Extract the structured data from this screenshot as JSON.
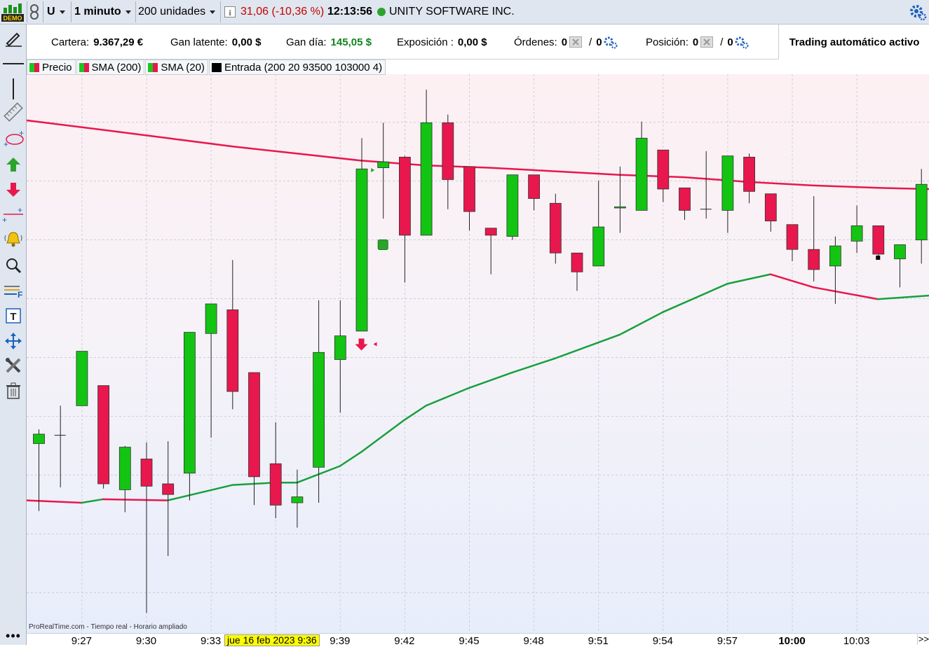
{
  "toolbar": {
    "demo_label": "DEMO",
    "ticker": "U",
    "timeframe": "1 minuto",
    "units": "200 unidades",
    "price_change": "31,06 (-10,36 %)",
    "time": "12:13:56",
    "instrument": "UNITY SOFTWARE INC.",
    "colors": {
      "price_change": "#c40000",
      "status_dot": "#2ca42c"
    }
  },
  "info": {
    "cartera_label": "Cartera:",
    "cartera_value": "9.367,29 €",
    "gan_latente_label": "Gan latente:",
    "gan_latente_value": "0,00 $",
    "gan_dia_label": "Gan día:",
    "gan_dia_value": "145,05 $",
    "exposicion_label": "Exposición :",
    "exposicion_value": "0,00 $",
    "ordenes_label": "Órdenes:",
    "ordenes_a": "0",
    "ordenes_b": "0",
    "posicion_label": "Posición:",
    "posicion_a": "0",
    "posicion_b": "0",
    "auto_trading": "Trading automático activo",
    "colors": {
      "gan_dia": "#12851d"
    }
  },
  "legend": [
    {
      "label": "Precio",
      "swatch": "red-green"
    },
    {
      "label": "SMA (200)",
      "swatch": "red-green"
    },
    {
      "label": "SMA (20)",
      "swatch": "red-green"
    },
    {
      "label": "Entrada (200 20 93500 103000 4)",
      "swatch": "black"
    }
  ],
  "left_tools": [
    "pencil-icon",
    "horizontal-line-icon",
    "vertical-line-icon",
    "ruler-icon",
    "ellipse-icon",
    "arrow-up-icon",
    "arrow-down-icon",
    "add-line-icon",
    "alarm-bell-icon",
    "magnifier-icon",
    "fibonacci-icon",
    "text-icon",
    "move-icon",
    "settings-tools-icon",
    "trash-icon"
  ],
  "footer_note": "ProRealTime.com - Tiempo real - Horario ampliado",
  "date_box": "jue 16 feb 2023 9:36",
  "chart_data": {
    "type": "candlestick",
    "x_labels": [
      "9:27",
      "9:30",
      "9:33",
      "9:36",
      "9:39",
      "9:42",
      "9:45",
      "9:48",
      "9:51",
      "9:54",
      "9:57",
      "10:00",
      "10:03"
    ],
    "x_label_bold": "10:00",
    "colors": {
      "up": "#13c413",
      "down": "#e8174d",
      "sma200": "#e8174d",
      "sma20_up": "#17a03c",
      "sma20_down": "#e8174d"
    },
    "candles": [
      {
        "t": "9:25",
        "o": 29.6,
        "h": 29.72,
        "l": 29.03,
        "c": 29.68
      },
      {
        "t": "9:26",
        "o": 29.67,
        "h": 29.92,
        "l": 29.23,
        "c": 29.67
      },
      {
        "t": "9:27",
        "o": 29.92,
        "h": 30.38,
        "l": 29.92,
        "c": 30.38
      },
      {
        "t": "9:28",
        "o": 30.09,
        "h": 30.09,
        "l": 29.22,
        "c": 29.26
      },
      {
        "t": "9:29",
        "o": 29.21,
        "h": 29.58,
        "l": 29.02,
        "c": 29.57
      },
      {
        "t": "9:30",
        "o": 29.47,
        "h": 29.61,
        "l": 28.17,
        "c": 29.24
      },
      {
        "t": "9:31",
        "o": 29.26,
        "h": 29.62,
        "l": 28.65,
        "c": 29.17
      },
      {
        "t": "9:32",
        "o": 29.35,
        "h": 30.54,
        "l": 29.12,
        "c": 30.54
      },
      {
        "t": "9:33",
        "o": 30.53,
        "h": 30.7,
        "l": 29.65,
        "c": 30.78
      },
      {
        "t": "9:34",
        "o": 30.73,
        "h": 31.15,
        "l": 29.89,
        "c": 30.04
      },
      {
        "t": "9:35",
        "o": 30.2,
        "h": 30.2,
        "l": 29.08,
        "c": 29.32
      },
      {
        "t": "9:36",
        "o": 29.43,
        "h": 29.78,
        "l": 28.97,
        "c": 29.08
      },
      {
        "t": "9:37",
        "o": 29.1,
        "h": 29.38,
        "l": 28.89,
        "c": 29.15
      },
      {
        "t": "9:38",
        "o": 29.4,
        "h": 30.81,
        "l": 29.1,
        "c": 30.37
      },
      {
        "t": "9:39",
        "o": 30.31,
        "h": 30.81,
        "l": 29.86,
        "c": 30.51
      },
      {
        "t": "9:40",
        "o": 30.55,
        "h": 32.18,
        "l": 30.55,
        "c": 31.92
      },
      {
        "t": "9:41",
        "o": 31.93,
        "h": 32.31,
        "l": 31.5,
        "c": 31.98
      },
      {
        "t": "9:42",
        "o": 32.02,
        "h": 32.03,
        "l": 30.96,
        "c": 31.36
      },
      {
        "t": "9:43",
        "o": 31.36,
        "h": 32.59,
        "l": 31.36,
        "c": 32.31
      },
      {
        "t": "9:44",
        "o": 32.31,
        "h": 32.38,
        "l": 31.58,
        "c": 31.83
      },
      {
        "t": "9:45",
        "o": 31.94,
        "h": 31.94,
        "l": 31.4,
        "c": 31.56
      },
      {
        "t": "9:46",
        "o": 31.42,
        "h": 31.42,
        "l": 31.03,
        "c": 31.36
      },
      {
        "t": "9:47",
        "o": 31.35,
        "h": 31.87,
        "l": 31.32,
        "c": 31.87
      },
      {
        "t": "9:48",
        "o": 31.87,
        "h": 31.87,
        "l": 31.57,
        "c": 31.67
      },
      {
        "t": "9:49",
        "o": 31.63,
        "h": 31.71,
        "l": 31.12,
        "c": 31.21
      },
      {
        "t": "9:50",
        "o": 31.21,
        "h": 31.21,
        "l": 30.89,
        "c": 31.05
      },
      {
        "t": "9:51",
        "o": 31.1,
        "h": 31.82,
        "l": 31.1,
        "c": 31.43
      },
      {
        "t": "9:52",
        "o": 31.59,
        "h": 31.94,
        "l": 31.38,
        "c": 31.6
      },
      {
        "t": "9:53",
        "o": 31.57,
        "h": 32.32,
        "l": 31.57,
        "c": 32.18
      },
      {
        "t": "9:54",
        "o": 32.08,
        "h": 32.08,
        "l": 31.64,
        "c": 31.75
      },
      {
        "t": "9:55",
        "o": 31.76,
        "h": 31.76,
        "l": 31.49,
        "c": 31.57
      },
      {
        "t": "9:56",
        "o": 31.58,
        "h": 32.07,
        "l": 31.5,
        "c": 31.58
      },
      {
        "t": "9:57",
        "o": 31.57,
        "h": 32.02,
        "l": 31.38,
        "c": 32.03
      },
      {
        "t": "9:58",
        "o": 32.02,
        "h": 32.05,
        "l": 31.63,
        "c": 31.73
      },
      {
        "t": "9:59",
        "o": 31.71,
        "h": 31.71,
        "l": 31.39,
        "c": 31.48
      },
      {
        "t": "10:00",
        "o": 31.45,
        "h": 31.45,
        "l": 31.14,
        "c": 31.24
      },
      {
        "t": "10:01",
        "o": 31.24,
        "h": 31.69,
        "l": 30.97,
        "c": 31.07
      },
      {
        "t": "10:02",
        "o": 31.1,
        "h": 31.35,
        "l": 30.78,
        "c": 31.27
      },
      {
        "t": "10:03",
        "o": 31.31,
        "h": 31.61,
        "l": 31.21,
        "c": 31.44
      },
      {
        "t": "10:04",
        "o": 31.44,
        "h": 31.44,
        "l": 31.17,
        "c": 31.2
      },
      {
        "t": "10:05",
        "o": 31.16,
        "h": 31.16,
        "l": 30.92,
        "c": 31.28
      },
      {
        "t": "10:06",
        "o": 31.32,
        "h": 31.92,
        "l": 31.12,
        "c": 31.79
      }
    ],
    "sma200": [
      {
        "t": "9:25",
        "v": 32.33
      },
      {
        "t": "9:28",
        "v": 32.25
      },
      {
        "t": "9:31",
        "v": 32.18
      },
      {
        "t": "9:34",
        "v": 32.11
      },
      {
        "t": "9:37",
        "v": 32.05
      },
      {
        "t": "9:40",
        "v": 31.99
      },
      {
        "t": "9:43",
        "v": 31.95
      },
      {
        "t": "9:46",
        "v": 31.93
      },
      {
        "t": "9:49",
        "v": 31.9
      },
      {
        "t": "9:52",
        "v": 31.87
      },
      {
        "t": "9:55",
        "v": 31.85
      },
      {
        "t": "9:58",
        "v": 31.81
      },
      {
        "t": "10:01",
        "v": 31.78
      },
      {
        "t": "10:04",
        "v": 31.76
      },
      {
        "t": "10:06",
        "v": 31.75
      }
    ],
    "sma20": [
      {
        "t": "9:25",
        "v": 29.12
      },
      {
        "t": "9:27",
        "v": 29.1
      },
      {
        "t": "9:28",
        "v": 29.13
      },
      {
        "t": "9:31",
        "v": 29.12
      },
      {
        "t": "9:34",
        "v": 29.25
      },
      {
        "t": "9:36",
        "v": 29.27
      },
      {
        "t": "9:37",
        "v": 29.27
      },
      {
        "t": "9:39",
        "v": 29.41
      },
      {
        "t": "9:40",
        "v": 29.53
      },
      {
        "t": "9:42",
        "v": 29.8
      },
      {
        "t": "9:43",
        "v": 29.92
      },
      {
        "t": "9:45",
        "v": 30.07
      },
      {
        "t": "9:47",
        "v": 30.2
      },
      {
        "t": "9:49",
        "v": 30.32
      },
      {
        "t": "9:52",
        "v": 30.52
      },
      {
        "t": "9:54",
        "v": 30.71
      },
      {
        "t": "9:57",
        "v": 30.95
      },
      {
        "t": "9:59",
        "v": 31.03
      },
      {
        "t": "10:01",
        "v": 30.92
      },
      {
        "t": "10:04",
        "v": 30.82
      },
      {
        "t": "10:06",
        "v": 30.85
      }
    ],
    "markers": [
      {
        "t": "9:41",
        "kind": "entry-square",
        "price": 31.28,
        "color": "#2ca42c"
      },
      {
        "t": "9:40",
        "kind": "sell-arrow",
        "price": 30.44,
        "color": "#e8174d"
      },
      {
        "t": "10:04",
        "kind": "entry-point",
        "price": 31.17,
        "color": "#000"
      }
    ]
  }
}
